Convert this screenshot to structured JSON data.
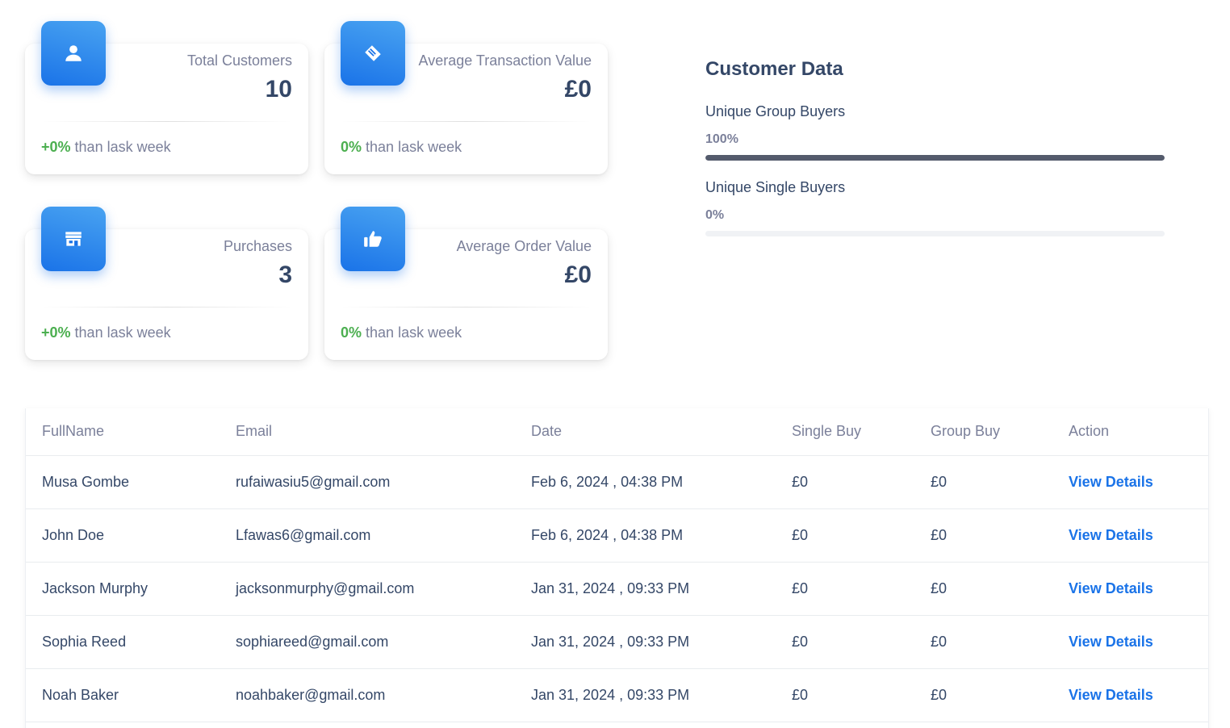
{
  "stats": [
    {
      "label": "Total Customers",
      "value": "10",
      "change": "+0%",
      "change_text": "than lask week",
      "icon": "user-icon"
    },
    {
      "label": "Average Transaction Value",
      "value": "£0",
      "change": "0%",
      "change_text": "than lask week",
      "icon": "handshake-icon"
    },
    {
      "label": "Purchases",
      "value": "3",
      "change": "+0%",
      "change_text": "than lask week",
      "icon": "store-icon"
    },
    {
      "label": "Average Order Value",
      "value": "£0",
      "change": "0%",
      "change_text": "than lask week",
      "icon": "thumbs-up-icon"
    }
  ],
  "customer_data": {
    "title": "Customer Data",
    "bars": [
      {
        "label": "Unique Group Buyers",
        "percent_text": "100%",
        "percent": 100
      },
      {
        "label": "Unique Single Buyers",
        "percent_text": "0%",
        "percent": 0
      }
    ]
  },
  "table": {
    "headers": [
      "FullName",
      "Email",
      "Date",
      "Single Buy",
      "Group Buy",
      "Action"
    ],
    "rows": [
      {
        "name": "Musa Gombe",
        "email": "rufaiwasiu5@gmail.com",
        "date": "Feb 6, 2024 , 04:38 PM",
        "single": "£0",
        "group": "£0",
        "action": "View Details"
      },
      {
        "name": "John Doe",
        "email": "Lfawas6@gmail.com",
        "date": "Feb 6, 2024 , 04:38 PM",
        "single": "£0",
        "group": "£0",
        "action": "View Details"
      },
      {
        "name": "Jackson Murphy",
        "email": "jacksonmurphy@gmail.com",
        "date": "Jan 31, 2024 , 09:33 PM",
        "single": "£0",
        "group": "£0",
        "action": "View Details"
      },
      {
        "name": "Sophia Reed",
        "email": "sophiareed@gmail.com",
        "date": "Jan 31, 2024 , 09:33 PM",
        "single": "£0",
        "group": "£0",
        "action": "View Details"
      },
      {
        "name": "Noah Baker",
        "email": "noahbaker@gmail.com",
        "date": "Jan 31, 2024 , 09:33 PM",
        "single": "£0",
        "group": "£0",
        "action": "View Details"
      }
    ]
  },
  "colors": {
    "accent": "#1A73E8",
    "positive": "#4CAF50",
    "bar_fill": "#545b6c"
  }
}
